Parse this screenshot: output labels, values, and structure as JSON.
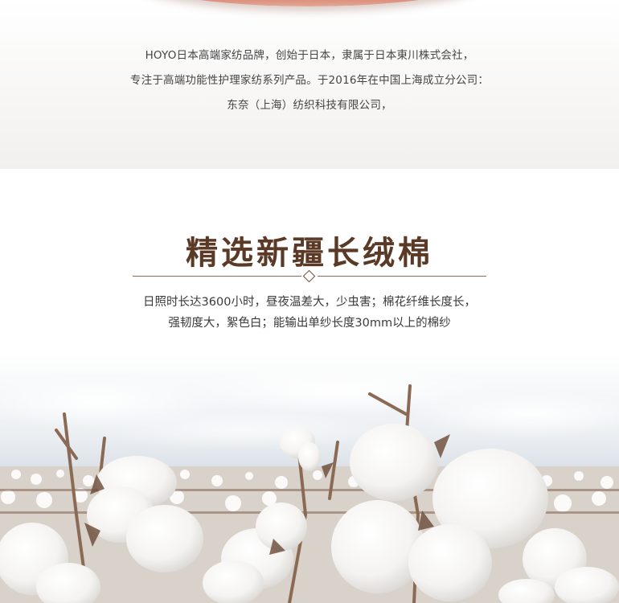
{
  "intro": {
    "lines": [
      "HOYO日本高端家纺品牌，创始于日本，隶属于日本東川株式会社，",
      "专注于高端功能性护理家纺系列产品。于2016年在中国上海成立分公司：",
      "东奈（上海）纺织科技有限公司，"
    ]
  },
  "feature": {
    "title": "精选新疆长绒棉",
    "lines": [
      "日照时长达3600小时，昼夜温差大，少虫害；棉花纤维长度长，",
      "强韧度大，絮色白；能输出单纱长度30mm以上的棉纱"
    ]
  },
  "colors": {
    "title": "#5a3a26",
    "text": "#3a3a3a",
    "product": "#c8604a"
  }
}
